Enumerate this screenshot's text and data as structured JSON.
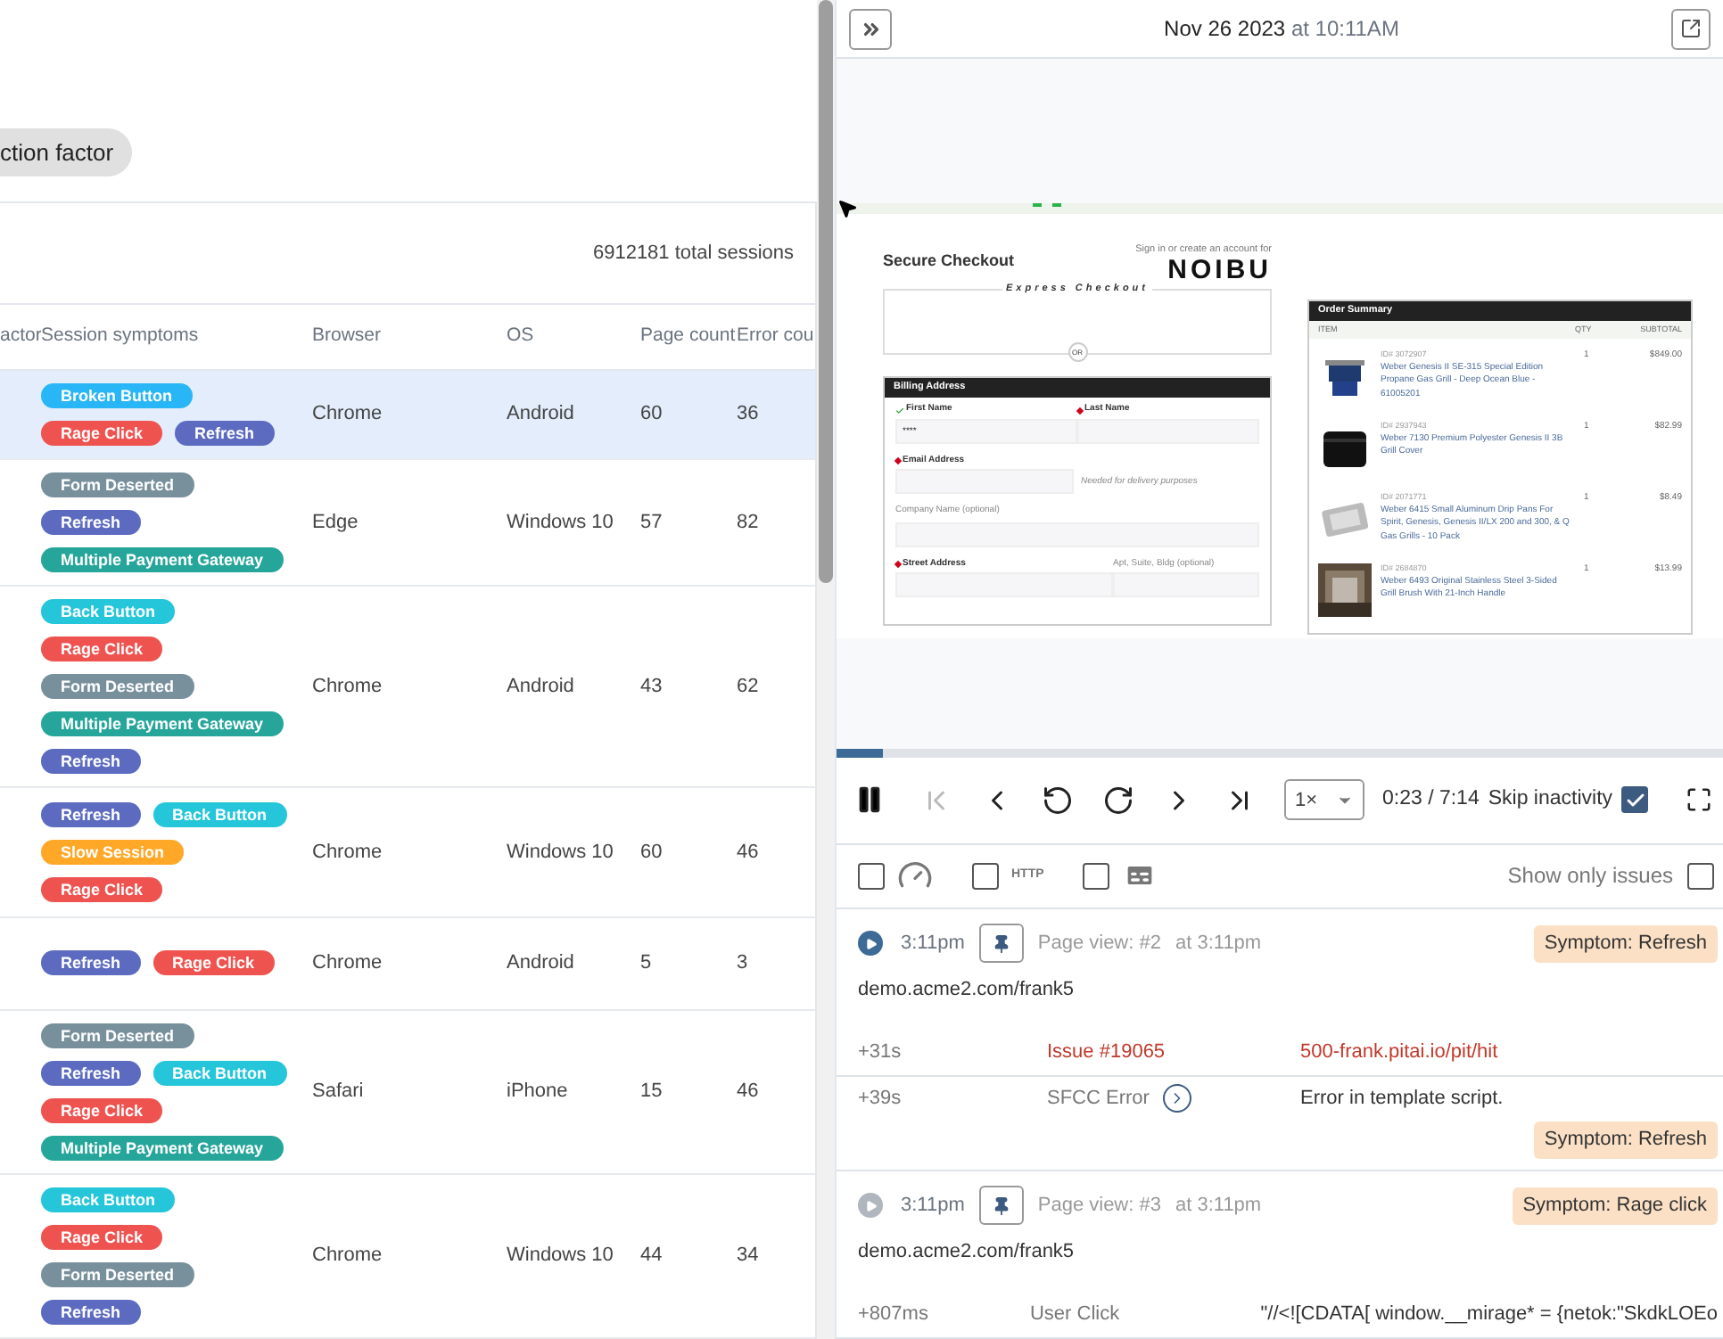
{
  "header": {
    "date": "Nov 26 2023",
    "time": "at 10:11AM"
  },
  "sessions": {
    "filter_chip": "ction factor",
    "total": "6912181 total sessions",
    "columns": [
      "actor",
      "Session symptoms",
      "Browser",
      "OS",
      "Page count",
      "Error cou"
    ],
    "rows": [
      {
        "selected": true,
        "tags": [
          {
            "label": "Broken Button",
            "color": "#29b6f6"
          },
          {
            "label": "Rage Click",
            "color": "#ef5350"
          },
          {
            "label": "Refresh",
            "color": "#5c6bc0"
          }
        ],
        "browser": "Chrome",
        "os": "Android",
        "pages": "60",
        "errors": "36"
      },
      {
        "selected": false,
        "tags": [
          {
            "label": "Form Deserted",
            "color": "#78909c"
          },
          {
            "label": "Refresh",
            "color": "#5c6bc0"
          },
          {
            "label": "Multiple Payment Gateway",
            "color": "#26a69a"
          }
        ],
        "browser": "Edge",
        "os": "Windows 10",
        "pages": "57",
        "errors": "82"
      },
      {
        "selected": false,
        "tags": [
          {
            "label": "Back Button",
            "color": "#26c6da"
          },
          {
            "label": "Rage Click",
            "color": "#ef5350"
          },
          {
            "label": "Form Deserted",
            "color": "#78909c"
          },
          {
            "label": "Multiple Payment Gateway",
            "color": "#26a69a"
          },
          {
            "label": "Refresh",
            "color": "#5c6bc0"
          }
        ],
        "browser": "Chrome",
        "os": "Android",
        "pages": "43",
        "errors": "62"
      },
      {
        "selected": false,
        "tags": [
          {
            "label": "Refresh",
            "color": "#5c6bc0"
          },
          {
            "label": "Back Button",
            "color": "#26c6da"
          },
          {
            "label": "Slow Session",
            "color": "#ffa726"
          },
          {
            "label": "Rage Click",
            "color": "#ef5350"
          }
        ],
        "browser": "Chrome",
        "os": "Windows 10",
        "pages": "60",
        "errors": "46"
      },
      {
        "selected": false,
        "tags": [
          {
            "label": "Refresh",
            "color": "#5c6bc0"
          },
          {
            "label": "Rage Click",
            "color": "#ef5350"
          }
        ],
        "browser": "Chrome",
        "os": "Android",
        "pages": "5",
        "errors": "3"
      },
      {
        "selected": false,
        "tags": [
          {
            "label": "Form Deserted",
            "color": "#78909c"
          },
          {
            "label": "Refresh",
            "color": "#5c6bc0"
          },
          {
            "label": "Back Button",
            "color": "#26c6da"
          },
          {
            "label": "Rage Click",
            "color": "#ef5350"
          },
          {
            "label": "Multiple Payment Gateway",
            "color": "#26a69a"
          }
        ],
        "browser": "Safari",
        "os": "iPhone",
        "pages": "15",
        "errors": "46"
      },
      {
        "selected": false,
        "tags": [
          {
            "label": "Back Button",
            "color": "#26c6da"
          },
          {
            "label": "Rage Click",
            "color": "#ef5350"
          },
          {
            "label": "Form Deserted",
            "color": "#78909c"
          },
          {
            "label": "Refresh",
            "color": "#5c6bc0"
          }
        ],
        "browser": "Chrome",
        "os": "Windows 10",
        "pages": "44",
        "errors": "34"
      }
    ]
  },
  "checkout": {
    "title": "Secure Checkout",
    "signin": "Sign in or create an account for",
    "logo": "NOIBU",
    "express": "Express Checkout",
    "or": "OR",
    "billing": "Billing Address",
    "first_name": "First Name",
    "first_value": "****",
    "last_name": "Last Name",
    "email": "Email Address",
    "email_note": "Needed for delivery purposes",
    "company": "Company Name (optional)",
    "street": "Street Address",
    "apt": "Apt, Suite, Bldg (optional)",
    "order_title": "Order Summary",
    "order_columns": [
      "ITEM",
      "QTY",
      "SUBTOTAL"
    ],
    "items": [
      {
        "id": "ID# 3072907",
        "name": "Weber Genesis II SE-315 Special Edition Propane Gas Grill - Deep Ocean Blue - 61005201",
        "qty": "1",
        "price": "$849.00"
      },
      {
        "id": "ID# 2937943",
        "name": "Weber 7130 Premium Polyester Genesis II 3B Grill Cover",
        "qty": "1",
        "price": "$82.99"
      },
      {
        "id": "ID# 2071771",
        "name": "Weber 6415 Small Aluminum Drip Pans For Spirit, Genesis, Genesis II/LX 200 and 300, & Q Gas Grills - 10 Pack",
        "qty": "1",
        "price": "$8.49"
      },
      {
        "id": "ID# 2684870",
        "name": "Weber 6493 Original Stainless Steel 3-Sided Grill Brush With 21-Inch Handle",
        "qty": "1",
        "price": "$13.99"
      }
    ]
  },
  "player": {
    "level": 0.053,
    "speed": "1×",
    "time": "0:23 / 7:14",
    "skip_label": "Skip inactivity",
    "skip_checked": true
  },
  "filters": [
    {
      "kind": "gauge",
      "checked": false
    },
    {
      "kind": "http",
      "label": "HTTP",
      "checked": false
    },
    {
      "kind": "captions",
      "checked": false
    }
  ],
  "show_only_issues": {
    "label": "Show only issues",
    "checked": false
  },
  "events": [
    {
      "active": true,
      "time": "3:11pm",
      "page_view": "Page view: #2",
      "at": "at 3:11pm",
      "badge": "Symptom: Refresh",
      "url": "demo.acme2.com/frank5",
      "details": [
        {
          "kind": "issue",
          "offset": "+31s",
          "type": "Issue #19065",
          "text": "500-frank.pitai.io/pit/hit"
        },
        {
          "kind": "error",
          "offset": "+39s",
          "type": "SFCC Error",
          "text": "Error in template script.",
          "badge": "Symptom: Refresh"
        }
      ]
    },
    {
      "active": false,
      "time": "3:11pm",
      "page_view": "Page view: #3",
      "at": "at 3:11pm",
      "badge": "Symptom: Rage click",
      "url": "demo.acme2.com/frank5",
      "details": [
        {
          "kind": "click",
          "offset": "+807ms",
          "type": "User Click",
          "text": "\"//<![CDATA[ window.__mirage* = {netok:\"SkdkLOEo"
        }
      ]
    }
  ]
}
